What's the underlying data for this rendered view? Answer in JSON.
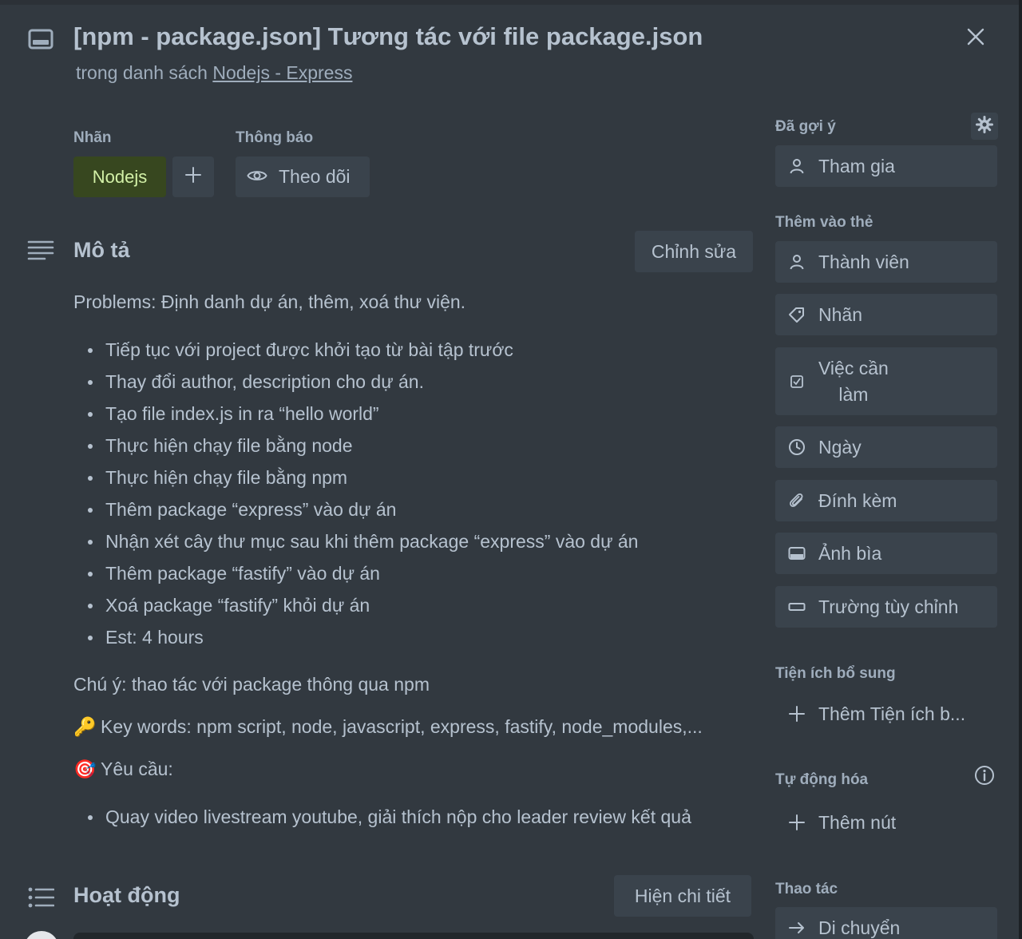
{
  "card": {
    "title": "[npm - package.json] Tương tác với file package.json",
    "list_prefix": "trong danh sách ",
    "list_name": "Nodejs - Express"
  },
  "labels": {
    "heading": "Nhãn",
    "items": [
      {
        "text": "Nodejs",
        "color": "#37471f"
      }
    ]
  },
  "notifications": {
    "heading": "Thông báo",
    "watch_label": "Theo dõi"
  },
  "description": {
    "heading": "Mô tả",
    "edit_label": "Chỉnh sửa",
    "intro": "Problems: Định danh dự án, thêm, xoá thư viện.",
    "bullets": [
      "Tiếp tục với project được khởi tạo từ bài tập trước",
      "Thay đổi author, description cho dự án.",
      "Tạo file index.js in ra “hello world”",
      "Thực hiện chạy file bằng node",
      "Thực hiện chạy file bằng npm",
      "Thêm package “express” vào dự án",
      "Nhận xét cây thư mục sau khi thêm package “express” vào dự án",
      "Thêm package “fastify” vào dự án",
      "Xoá package “fastify” khỏi dự án",
      "Est: 4 hours"
    ],
    "note": "Chú ý: thao tác với package thông qua npm",
    "keywords_emoji": "🔑",
    "keywords": "Key words: npm script, node, javascript, express, fastify, node_modules,...",
    "requirements_emoji": "🎯",
    "requirements_heading": "Yêu cầu:",
    "requirements": [
      "Quay video livestream youtube, giải thích nộp cho leader review kết quả"
    ]
  },
  "activity": {
    "heading": "Hoạt động",
    "details_label": "Hiện chi tiết"
  },
  "sidebar": {
    "suggested_heading": "Đã gợi ý",
    "join_label": "Tham gia",
    "add_to_card_heading": "Thêm vào thẻ",
    "members_label": "Thành viên",
    "labels_label": "Nhãn",
    "checklist_label_line1": "Việc cần",
    "checklist_label_line2": "làm",
    "dates_label": "Ngày",
    "attachment_label": "Đính kèm",
    "cover_label": "Ảnh bìa",
    "custom_fields_label": "Trường tùy chỉnh",
    "powerups_heading": "Tiện ích bổ sung",
    "add_powerup_label": "Thêm Tiện ích b...",
    "automation_heading": "Tự động hóa",
    "add_button_label": "Thêm nút",
    "actions_heading": "Thao tác",
    "move_label": "Di chuyển"
  },
  "icons": {
    "card": "card-icon",
    "close": "close-icon",
    "description": "description-lines-icon",
    "activity": "activity-list-icon",
    "eye": "eye-icon",
    "plus": "plus-icon",
    "gear": "gear-icon",
    "info": "info-icon"
  },
  "colors": {
    "background": "#323940",
    "button": "#3a434c",
    "text": "#b6c2cf",
    "label_green_bg": "#37471f",
    "label_green_text": "#d3f1a7"
  }
}
